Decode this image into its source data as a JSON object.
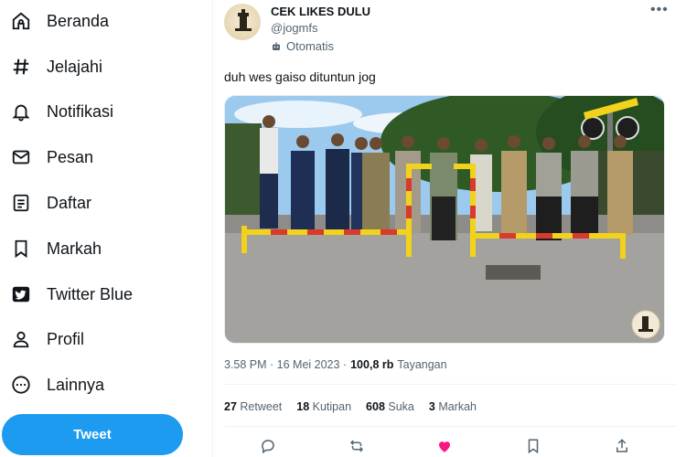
{
  "sidebar": {
    "items": [
      {
        "label": "Beranda",
        "icon": "home-icon"
      },
      {
        "label": "Jelajahi",
        "icon": "hashtag-icon"
      },
      {
        "label": "Notifikasi",
        "icon": "bell-icon"
      },
      {
        "label": "Pesan",
        "icon": "envelope-icon"
      },
      {
        "label": "Daftar",
        "icon": "list-icon"
      },
      {
        "label": "Markah",
        "icon": "bookmark-icon"
      },
      {
        "label": "Twitter Blue",
        "icon": "twitter-blue-icon"
      },
      {
        "label": "Profil",
        "icon": "person-icon"
      },
      {
        "label": "Lainnya",
        "icon": "more-circle-icon"
      }
    ],
    "tweet_button": "Tweet"
  },
  "tweet": {
    "display_name": "CEK LIKES DULU",
    "handle": "@jogmfs",
    "automated_label": "Otomatis",
    "text": "duh wes gaiso dituntun jog",
    "time": "3.58 PM · 16 Mei 2023 ·",
    "views": "100,8 rb",
    "views_label": "Tayangan",
    "stats": {
      "retweets": {
        "count": "27",
        "label": "Retweet"
      },
      "quotes": {
        "count": "18",
        "label": "Kutipan"
      },
      "likes": {
        "count": "608",
        "label": "Suka"
      },
      "bookmarks": {
        "count": "3",
        "label": "Markah"
      }
    }
  },
  "colors": {
    "accent": "#1d9bf0",
    "like": "#f91880",
    "muted": "#536471",
    "barrier_yellow": "#f2d21b",
    "barrier_red": "#d93a2b"
  }
}
